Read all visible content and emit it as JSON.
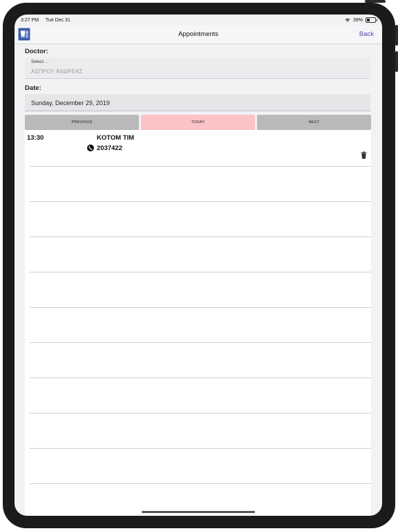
{
  "status_bar": {
    "time": "3:27 PM",
    "date": "Tue Dec 31",
    "battery_percent": "39%",
    "battery_level": 0.39
  },
  "nav": {
    "title": "Appointments",
    "back_label": "Back"
  },
  "form": {
    "doctor_label": "Doctor:",
    "doctor_caption": "Select ...",
    "doctor_value": "ΑΣΠΡΟΥ ΑΝΔΡΕΑΣ",
    "date_label": "Date:",
    "date_value": "Sunday, December 29, 2019"
  },
  "day_nav": {
    "previous": "PREVIOUS",
    "today": "TODAY",
    "next": "NEXT"
  },
  "appointments": [
    {
      "time": "13:30",
      "name": "KOTOM TIM",
      "phone": "2037422"
    }
  ],
  "colors": {
    "accent": "#5b3fb0",
    "today_button": "#fbc3c6",
    "nav_button": "#b9b9b9"
  },
  "icons": [
    "app-logo-icon",
    "wifi-icon",
    "battery-icon",
    "phone-icon",
    "trash-icon"
  ]
}
